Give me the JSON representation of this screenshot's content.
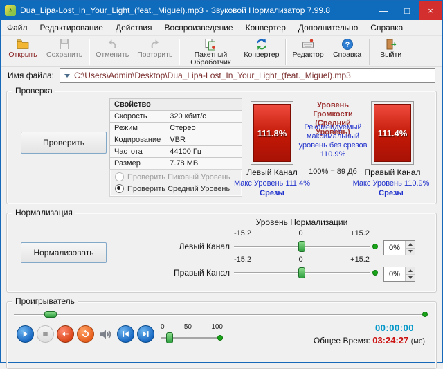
{
  "window": {
    "title": "Dua_Lipa-Lost_In_Your_Light_(feat._Miguel).mp3 - Звуковой Нормализатор 7.99.8",
    "icon_glyph": "♪",
    "controls": {
      "minimize": "—",
      "maximize": "□",
      "close": "×"
    }
  },
  "menu": {
    "items": [
      "Файл",
      "Редактирование",
      "Действия",
      "Воспроизведение",
      "Конвертер",
      "Дополнительно",
      "Справка"
    ]
  },
  "toolbar": {
    "items": [
      {
        "label": "Открыть",
        "enabled": true
      },
      {
        "label": "Сохранить",
        "enabled": false
      },
      {
        "label": "Отменить",
        "enabled": false
      },
      {
        "label": "Повторить",
        "enabled": false
      },
      {
        "label": "Пакетный Обработчик",
        "enabled": true
      },
      {
        "label": "Конвертер",
        "enabled": true
      },
      {
        "label": "Редактор",
        "enabled": true
      },
      {
        "label": "Справка",
        "enabled": true
      },
      {
        "label": "Выйти",
        "enabled": true
      }
    ]
  },
  "file": {
    "label": "Имя файла:",
    "value": "C:\\Users\\Admin\\Desktop\\Dua_Lipa-Lost_In_Your_Light_(feat._Miguel).mp3"
  },
  "check": {
    "group_label": "Проверка",
    "button": "Проверить",
    "properties": {
      "header": "Свойство",
      "rows": [
        [
          "Скорость",
          "320 кбит/с"
        ],
        [
          "Режим",
          "Стерео"
        ],
        [
          "Кодирование",
          "VBR"
        ],
        [
          "Частота",
          "44100 Гц"
        ],
        [
          "Размер",
          "7.78 МВ"
        ]
      ]
    },
    "radio_peak": "Проверить Пиковый Уровень",
    "radio_avg": "Проверить Средний Уровень",
    "left_meter": {
      "value": "111.8%",
      "label": "Левый Канал",
      "max": "Макс Уровень 111.4%",
      "clips": "Срезы"
    },
    "right_meter": {
      "value": "111.4%",
      "label": "Правый Канал",
      "max": "Макс Уровень 110.9%",
      "clips": "Срезы"
    },
    "center": {
      "title": "Уровень Громкости (Средний Уровень)",
      "recommend": "Рекомендуемый максимальный уровень без срезов 110.9%",
      "scale_note": "100% = 89 Дб"
    }
  },
  "normalize": {
    "group_label": "Нормализация",
    "button": "Нормализовать",
    "title": "Уровень Нормализации",
    "left_label": "Левый Канал",
    "right_label": "Правый Канал",
    "scale": {
      "min": "-15.2",
      "mid": "0",
      "max": "+15.2"
    },
    "left_value": "0%",
    "right_value": "0%"
  },
  "player": {
    "group_label": "Проигрыватель",
    "volume_scale": [
      "0",
      "50",
      "100"
    ],
    "current_time": "00:00:00",
    "total_label": "Общее Время:",
    "total_time": "03:24:27",
    "total_units": "(мс)"
  },
  "colors": {
    "titlebar": "#0f6cbd",
    "meter_red": "#c21807",
    "link_blue": "#2233cc",
    "value_red": "#cc1111",
    "path_maroon": "#7b2e2e",
    "thumb_green": "#2e9e3e"
  }
}
